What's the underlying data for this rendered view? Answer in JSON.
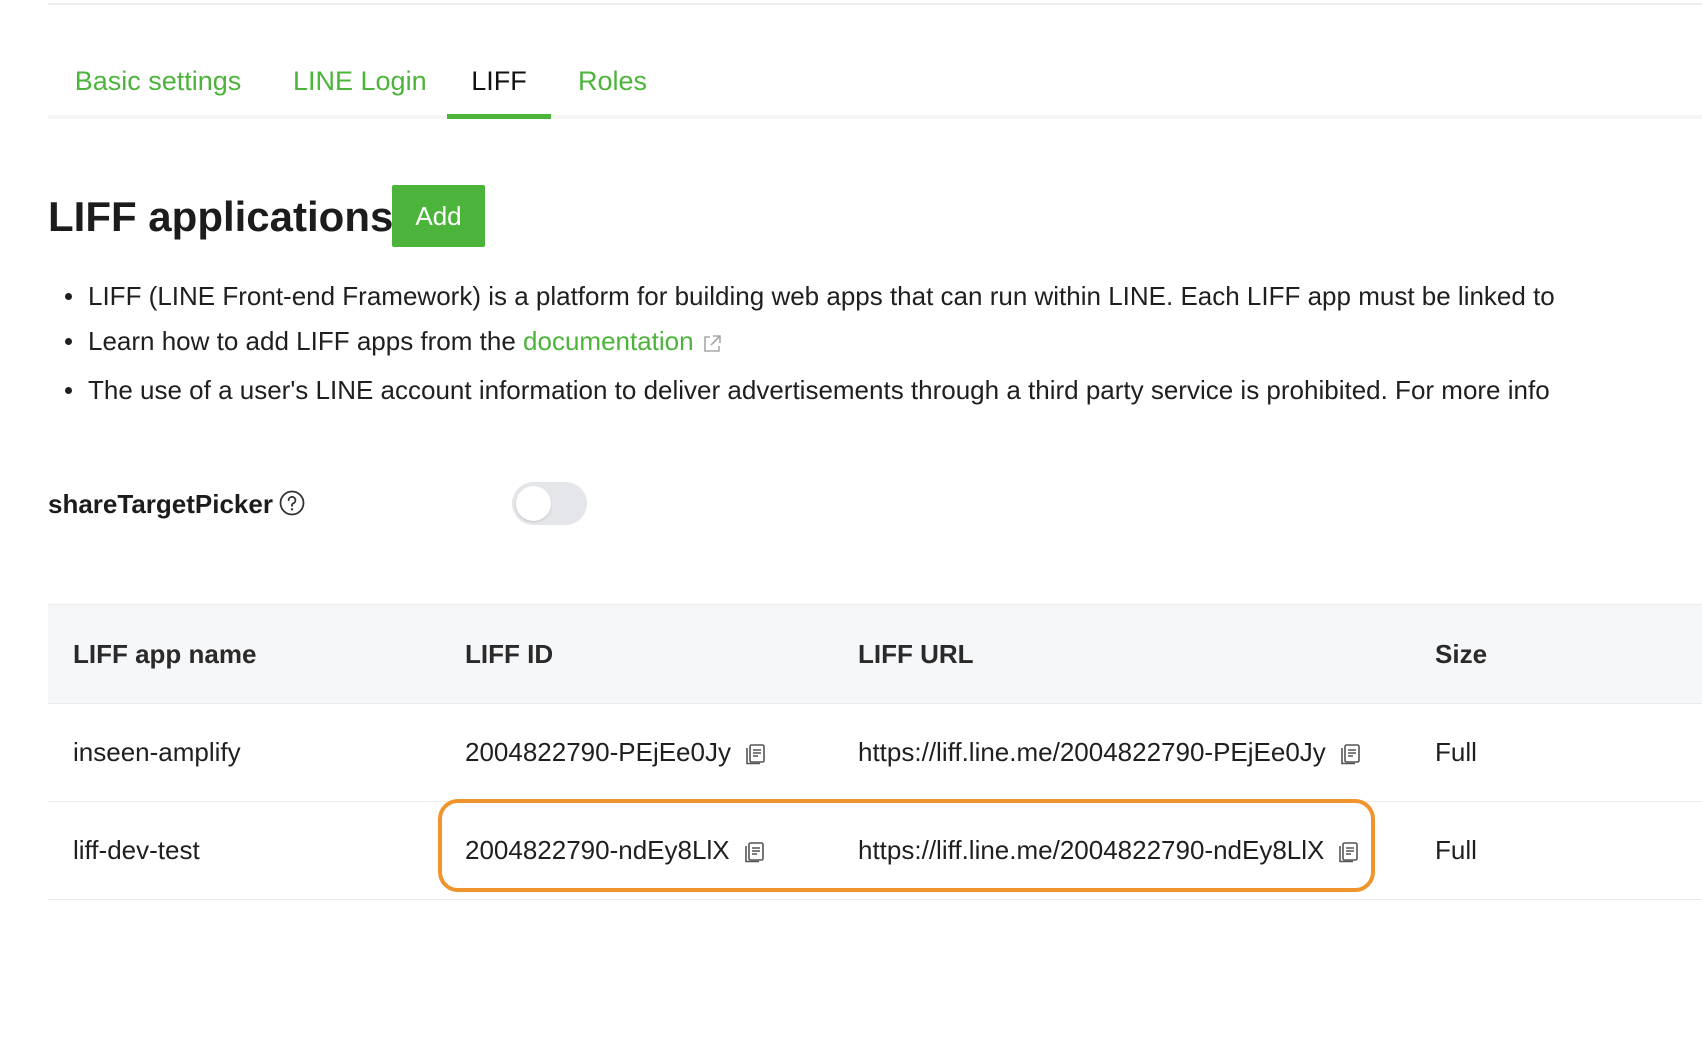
{
  "tabs": [
    {
      "label": "Basic settings",
      "active": false
    },
    {
      "label": "LINE Login",
      "active": false
    },
    {
      "label": "LIFF",
      "active": true
    },
    {
      "label": "Roles",
      "active": false
    }
  ],
  "section": {
    "title": "LIFF applications",
    "add_label": "Add"
  },
  "notes": {
    "item1": "LIFF (LINE Front-end Framework) is a platform for building web apps that can run within LINE. Each LIFF app must be linked to",
    "item2_prefix": "Learn how to add LIFF apps from the ",
    "item2_link": "documentation",
    "item3": "The use of a user's LINE account information to deliver advertisements through a third party service is prohibited. For more info"
  },
  "share_target_picker": {
    "label": "shareTargetPicker",
    "enabled": false
  },
  "table": {
    "headers": [
      "LIFF app name",
      "LIFF ID",
      "LIFF URL",
      "Size"
    ],
    "rows": [
      {
        "name": "inseen-amplify",
        "id": "2004822790-PEjEe0Jy",
        "url": "https://liff.line.me/2004822790-PEjEe0Jy",
        "size": "Full"
      },
      {
        "name": "liff-dev-test",
        "id": "2004822790-ndEy8LlX",
        "url": "https://liff.line.me/2004822790-ndEy8LlX",
        "size": "Full"
      }
    ]
  },
  "colors": {
    "accent": "#4cb43a",
    "highlight": "#f0952e",
    "toggle_off": "#e4e6e9",
    "header_bg": "#f6f7f9"
  }
}
